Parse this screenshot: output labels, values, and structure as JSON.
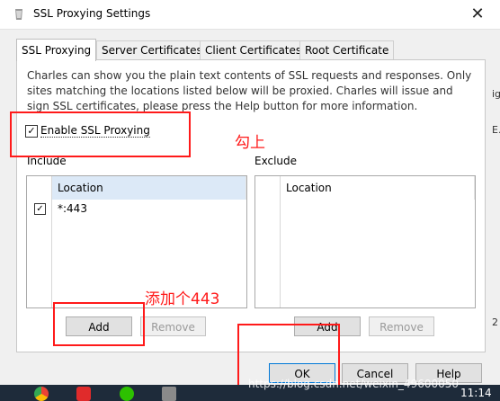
{
  "window": {
    "title": "SSL Proxying Settings",
    "close_glyph": "✕"
  },
  "tabs": [
    {
      "label": "SSL Proxying",
      "active": true
    },
    {
      "label": "Server Certificates",
      "active": false
    },
    {
      "label": "Client Certificates",
      "active": false
    },
    {
      "label": "Root Certificate",
      "active": false
    }
  ],
  "description": "Charles can show you the plain text contents of SSL requests and responses. Only sites matching the locations listed below will be proxied. Charles will issue and sign SSL certificates, please press the Help button for more information.",
  "enable_ssl": {
    "label": "Enable SSL Proxying",
    "checked": true
  },
  "include": {
    "label": "Include",
    "column": "Location",
    "rows": [
      {
        "checked": true,
        "location": "*:443"
      }
    ],
    "add": "Add",
    "remove": "Remove"
  },
  "exclude": {
    "label": "Exclude",
    "column": "Location",
    "add": "Add",
    "remove": "Remove"
  },
  "footer": {
    "ok": "OK",
    "cancel": "Cancel",
    "help": "Help"
  },
  "annotations": {
    "check_on": "勾上",
    "add_443": "添加个443",
    "color": "#ff1a1a"
  },
  "taskbar": {
    "watermark": "https://blog.csdn.net/weixin_49600050",
    "time": "11:14",
    "icons": [
      "chrome-icon",
      "app-red-icon",
      "wechat-icon",
      "charles-icon"
    ]
  },
  "right_edge_fragments": [
    "ig",
    "E.",
    "2"
  ]
}
